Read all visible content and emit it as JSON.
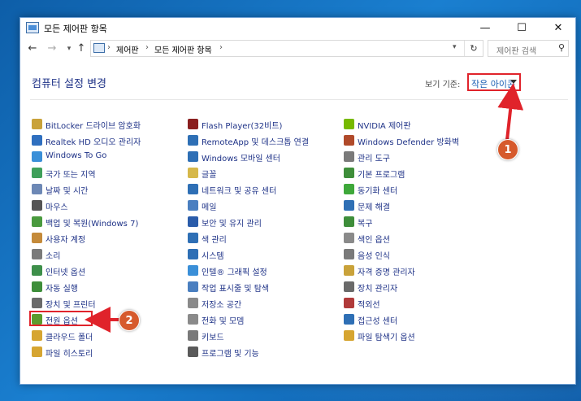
{
  "window": {
    "title": "모든 제어판 항목",
    "minimize_glyph": "—",
    "maximize_glyph": "☐",
    "close_glyph": "✕"
  },
  "nav": {
    "back_glyph": "←",
    "forward_glyph": "→",
    "dropdown_glyph": "▾",
    "up_glyph": "↑",
    "breadcrumb": [
      "제어판",
      "모든 제어판 항목"
    ],
    "separator": "›",
    "refresh_glyph": "↻",
    "search_placeholder": "제어판 검색",
    "search_glyph": "⚲"
  },
  "header": {
    "title": "컴퓨터 설정 변경",
    "view_by_label": "보기 기준:",
    "view_by_value": "작은 아이콘"
  },
  "columns": [
    [
      {
        "label": "BitLocker 드라이브 암호화",
        "icon": "bitlocker-icon",
        "color": "#c9a23a"
      },
      {
        "label": "Realtek HD 오디오 관리자",
        "icon": "realtek-audio-icon",
        "color": "#2f6fbf"
      },
      {
        "label": "Windows To Go",
        "icon": "windows-to-go-icon",
        "color": "#3a8fd8"
      },
      {
        "label": "국가 또는 지역",
        "icon": "region-icon",
        "color": "#3fa05a"
      },
      {
        "label": "날짜 및 시간",
        "icon": "date-time-icon",
        "color": "#6d88b5"
      },
      {
        "label": "마우스",
        "icon": "mouse-icon",
        "color": "#555555"
      },
      {
        "label": "백업 및 복원(Windows 7)",
        "icon": "backup-restore-icon",
        "color": "#4a9a3e"
      },
      {
        "label": "사용자 계정",
        "icon": "user-accounts-icon",
        "color": "#c48a3a"
      },
      {
        "label": "소리",
        "icon": "sound-icon",
        "color": "#7a7a7a"
      },
      {
        "label": "인터넷 옵션",
        "icon": "internet-options-icon",
        "color": "#3d8f4a"
      },
      {
        "label": "자동 실행",
        "icon": "autoplay-icon",
        "color": "#3e8e3a"
      },
      {
        "label": "장치 및 프린터",
        "icon": "devices-printers-icon",
        "color": "#6a6a6a"
      },
      {
        "label": "전원 옵션",
        "icon": "power-options-icon",
        "color": "#5c9b2e"
      },
      {
        "label": "클라우드 폴더",
        "icon": "work-folders-icon",
        "color": "#d6a531"
      },
      {
        "label": "파일 히스토리",
        "icon": "file-history-icon",
        "color": "#d6a531"
      }
    ],
    [
      {
        "label": "Flash Player(32비트)",
        "icon": "flash-player-icon",
        "color": "#8a1f1f"
      },
      {
        "label": "RemoteApp 및 데스크톱 연결",
        "icon": "remoteapp-icon",
        "color": "#2e6fb5"
      },
      {
        "label": "Windows 모바일 센터",
        "icon": "mobility-center-icon",
        "color": "#2e6fb5"
      },
      {
        "label": "글꼴",
        "icon": "fonts-icon",
        "color": "#d6b84a"
      },
      {
        "label": "네트워크 및 공유 센터",
        "icon": "network-sharing-icon",
        "color": "#2e6fb5"
      },
      {
        "label": "메일",
        "icon": "mail-icon",
        "color": "#4a7fc0"
      },
      {
        "label": "보안 및 유지 관리",
        "icon": "security-maintenance-icon",
        "color": "#2a5caa"
      },
      {
        "label": "색 관리",
        "icon": "color-management-icon",
        "color": "#2e6fb5"
      },
      {
        "label": "시스템",
        "icon": "system-icon",
        "color": "#2e6fb5"
      },
      {
        "label": "인텔® 그래픽 설정",
        "icon": "intel-graphics-icon",
        "color": "#3a8fd8"
      },
      {
        "label": "작업 표시줄 및 탐색",
        "icon": "taskbar-navigation-icon",
        "color": "#4a7fc0"
      },
      {
        "label": "저장소 공간",
        "icon": "storage-spaces-icon",
        "color": "#8a8a8a"
      },
      {
        "label": "전화 및 모뎀",
        "icon": "phone-modem-icon",
        "color": "#8a8a8a"
      },
      {
        "label": "키보드",
        "icon": "keyboard-icon",
        "color": "#7a7a7a"
      },
      {
        "label": "프로그램 및 기능",
        "icon": "programs-features-icon",
        "color": "#5a5a5a"
      }
    ],
    [
      {
        "label": "NVIDIA 제어판",
        "icon": "nvidia-icon",
        "color": "#76b900"
      },
      {
        "label": "Windows Defender 방화벽",
        "icon": "firewall-icon",
        "color": "#b04a2a"
      },
      {
        "label": "관리 도구",
        "icon": "admin-tools-icon",
        "color": "#7a7a7a"
      },
      {
        "label": "기본 프로그램",
        "icon": "default-programs-icon",
        "color": "#3e8e3a"
      },
      {
        "label": "동기화 센터",
        "icon": "sync-center-icon",
        "color": "#3ea83a"
      },
      {
        "label": "문제 해결",
        "icon": "troubleshooting-icon",
        "color": "#2e6fb5"
      },
      {
        "label": "복구",
        "icon": "recovery-icon",
        "color": "#3e8e3a"
      },
      {
        "label": "색인 옵션",
        "icon": "indexing-options-icon",
        "color": "#8a8a8a"
      },
      {
        "label": "음성 인식",
        "icon": "speech-recognition-icon",
        "color": "#7a7a7a"
      },
      {
        "label": "자격 증명 관리자",
        "icon": "credential-manager-icon",
        "color": "#c9a23a"
      },
      {
        "label": "장치 관리자",
        "icon": "device-manager-icon",
        "color": "#6a6a6a"
      },
      {
        "label": "적외선",
        "icon": "infrared-icon",
        "color": "#b03a3a"
      },
      {
        "label": "접근성 센터",
        "icon": "ease-of-access-icon",
        "color": "#2e6fb5"
      },
      {
        "label": "파일 탐색기 옵션",
        "icon": "file-explorer-options-icon",
        "color": "#d6a531"
      }
    ]
  ],
  "annotations": [
    {
      "number": "1",
      "color": "#d65a2d"
    },
    {
      "number": "2",
      "color": "#d65a2d"
    }
  ]
}
